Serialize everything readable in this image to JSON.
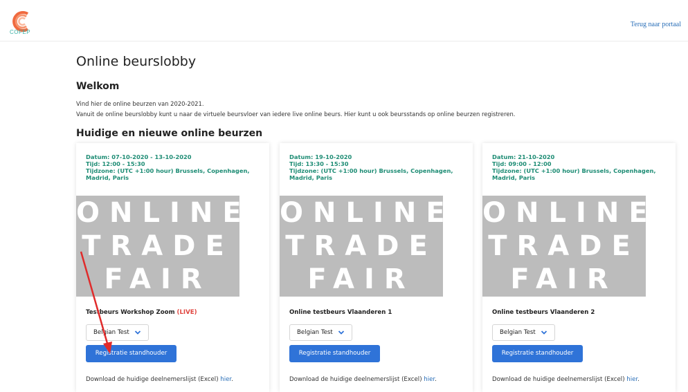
{
  "header": {
    "logo_text": "COFEP",
    "portal_link": "Terug naar portaal"
  },
  "page": {
    "title": "Online beurslobby",
    "welcome_heading": "Welkom",
    "intro_line1": "Vind hier de online beurzen van 2020-2021.",
    "intro_line2": "Vanuit de online beurslobby kunt u naar de virtuele beursvloer van iedere live online beurs. Hier kunt u ook beursstands op online beurzen registreren.",
    "section_title": "Huidige en nieuwe online beurzen"
  },
  "cards": [
    {
      "date": "Datum: 07-10-2020 - 13-10-2020",
      "time": "Tijd: 12:00 - 15:30",
      "timezone": "Tijdzone: (UTC +1:00 hour) Brussels, Copenhagen, Madrid, Paris",
      "banner_lines": [
        "ONLINE",
        "TRADE",
        "FAIR"
      ],
      "title": "Testbeurs Workshop Zoom",
      "live_label": "(LIVE)",
      "select_value": "Belgian Test",
      "register_label": "Registratie standhouder",
      "download_text": "Download de huidige deelnemerslijst (Excel)",
      "download_link": "hier"
    },
    {
      "date": "Datum: 19-10-2020",
      "time": "Tijd: 13:30 - 15:30",
      "timezone": "Tijdzone: (UTC +1:00 hour) Brussels, Copenhagen, Madrid, Paris",
      "banner_lines": [
        "ONLINE",
        "TRADE",
        "FAIR"
      ],
      "title": "Online testbeurs Vlaanderen 1",
      "live_label": "",
      "select_value": "Belgian Test",
      "register_label": "Registratie standhouder",
      "download_text": "Download de huidige deelnemerslijst (Excel)",
      "download_link": "hier"
    },
    {
      "date": "Datum: 21-10-2020",
      "time": "Tijd: 09:00 - 12:00",
      "timezone": "Tijdzone: (UTC +1:00 hour) Brussels, Copenhagen, Madrid, Paris",
      "banner_lines": [
        "ONLINE",
        "TRADE",
        "FAIR"
      ],
      "title": "Online testbeurs Vlaanderen 2",
      "live_label": "",
      "select_value": "Belgian Test",
      "register_label": "Registratie standhouder",
      "download_text": "Download de huidige deelnemerslijst (Excel)",
      "download_link": "hier"
    }
  ],
  "colors": {
    "accent_blue": "#2f73d8",
    "info_green": "#1d8c74",
    "live_red": "#e0453f",
    "banner_gray": "#bcbcbc",
    "logo_orange": "#f06a3f",
    "annotation_arrow": "#e02b2b"
  }
}
